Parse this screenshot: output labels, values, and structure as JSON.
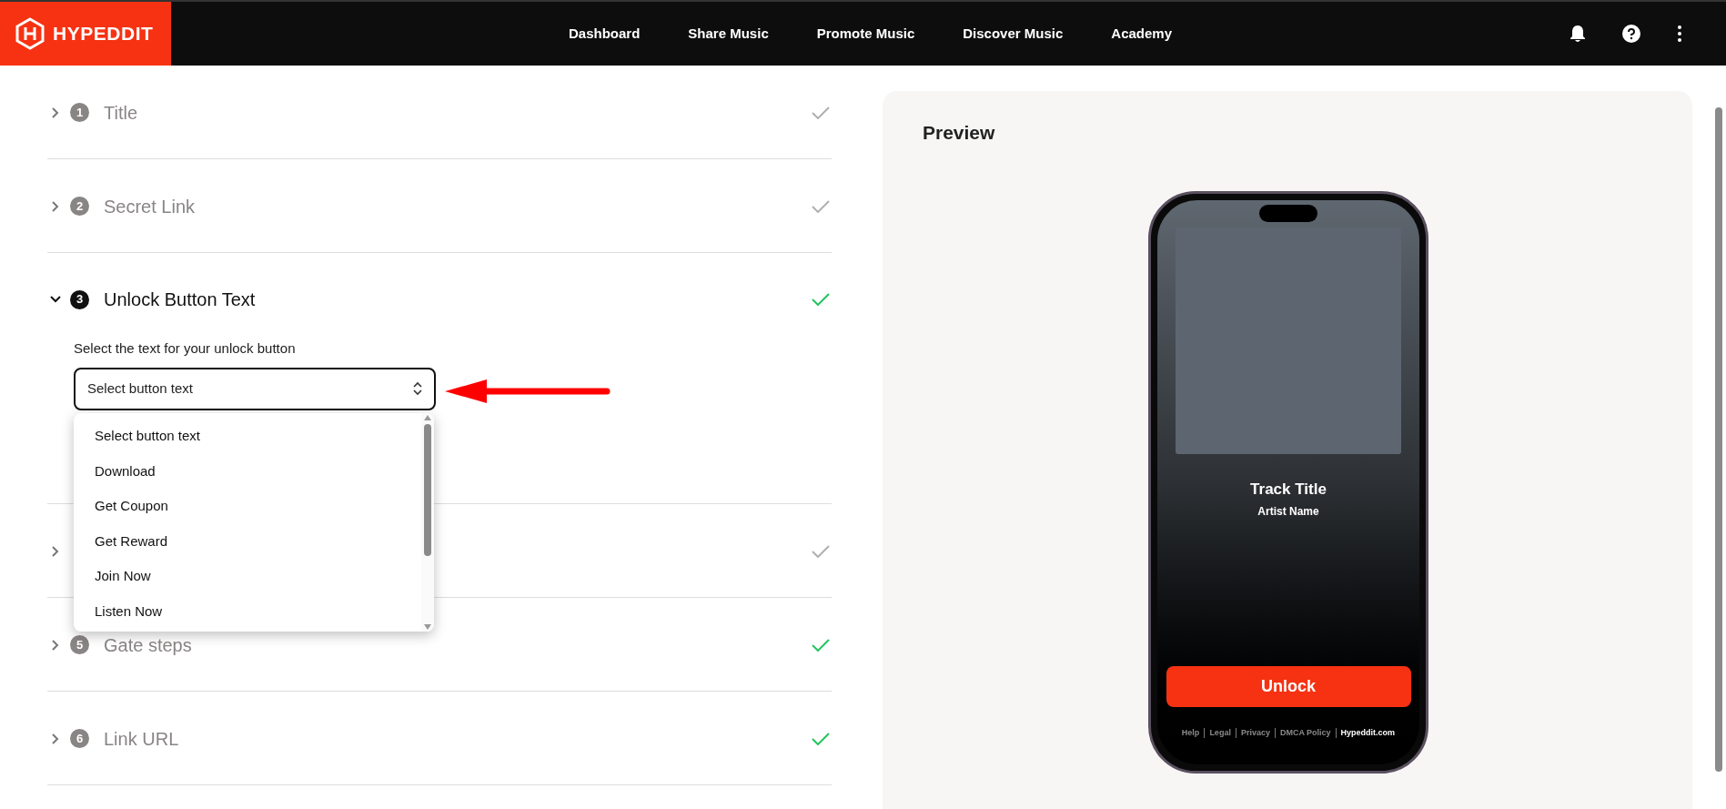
{
  "brand": {
    "name": "HYPEDDIT"
  },
  "nav": [
    "Dashboard",
    "Share Music",
    "Promote Music",
    "Discover Music",
    "Academy"
  ],
  "steps": [
    {
      "number": "1",
      "title": "Title",
      "expanded": false,
      "completed": false
    },
    {
      "number": "2",
      "title": "Secret Link",
      "expanded": false,
      "completed": false
    },
    {
      "number": "3",
      "title": "Unlock Button Text",
      "expanded": true,
      "completed": true,
      "field_label": "Select the text for your unlock button",
      "select": {
        "value": "Select button text",
        "open": true,
        "options": [
          "Select button text",
          "Download",
          "Get Coupon",
          "Get Reward",
          "Join Now",
          "Listen Now"
        ]
      }
    },
    {
      "expanded": false,
      "completed": false
    },
    {
      "number": "5",
      "title": "Gate steps",
      "expanded": false,
      "completed": true
    },
    {
      "number": "6",
      "title": "Link URL",
      "expanded": false,
      "completed": true
    }
  ],
  "preview": {
    "title": "Preview",
    "track_title": "Track Title",
    "artist_name": "Artist Name",
    "button": "Unlock",
    "footer_links": [
      {
        "label": "Help",
        "strong": false
      },
      {
        "label": "Legal",
        "strong": false
      },
      {
        "label": "Privacy",
        "strong": false
      },
      {
        "label": "DMCA Policy",
        "strong": false
      },
      {
        "label": "Hypeddit.com",
        "strong": true
      }
    ]
  }
}
